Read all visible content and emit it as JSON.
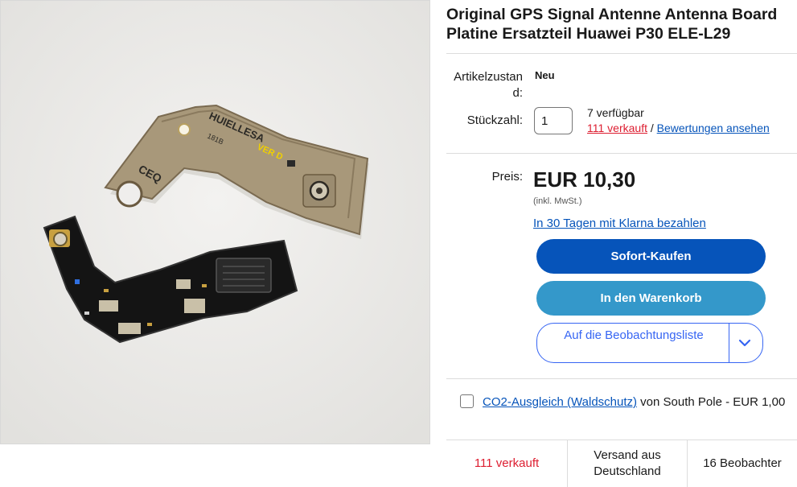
{
  "title": "Original GPS Signal Antenne Antenna Board Platine Ersatzteil Huawei P30 ELE-L29",
  "condition": {
    "label": "Artikelzustand:",
    "value": "Neu"
  },
  "quantity": {
    "label": "Stückzahl:",
    "value": "1",
    "available": "7 verfügbar",
    "sold": "111 verkauft",
    "separator": " / ",
    "reviews": "Bewertungen ansehen"
  },
  "price": {
    "label": "Preis:",
    "amount": "EUR 10,30",
    "vat_note": "(inkl. MwSt.)",
    "klarna": "In 30 Tagen mit Klarna bezahlen"
  },
  "buttons": {
    "buy_now": "Sofort-Kaufen",
    "add_to_cart": "In den Warenkorb",
    "watchlist": "Auf die Beobachtungsliste"
  },
  "co2": {
    "link": "CO2-Ausgleich (Waldschutz)",
    "rest": " von South Pole - EUR 1,00"
  },
  "stats": {
    "sold": "111 verkauft",
    "shipping": "Versand aus Deutschland",
    "watchers": "16 Beobachter"
  },
  "image": {
    "pcb_text_1": "CEQ",
    "pcb_text_2": "HUIELLESA",
    "pcb_text_3": "VER D",
    "pcb_text_4": "181B"
  },
  "colors": {
    "primary_blue": "#0654ba",
    "cart_blue": "#3498ca",
    "sold_red": "#dd1e31",
    "outline_blue": "#3665f3"
  }
}
